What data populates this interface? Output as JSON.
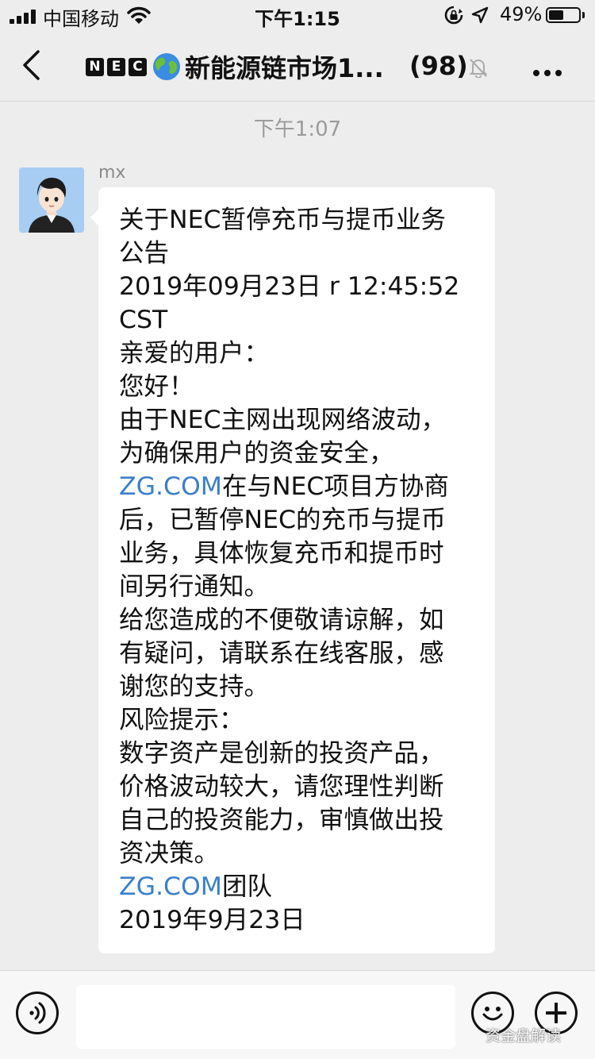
{
  "status_bar": {
    "carrier": "中国移动",
    "time": "下午1:15",
    "battery_percent": "49%",
    "battery_level": 0.49
  },
  "nav": {
    "title": "新能源链市场1...",
    "member_count": "(98)",
    "logo_letters": [
      "N",
      "E",
      "C"
    ],
    "icons": [
      "back-chevron-icon",
      "globe-icon",
      "mute-bell-icon",
      "more-icon"
    ]
  },
  "chat": {
    "time_label": "下午1:07",
    "sender": "mx",
    "message_lines": [
      {
        "text": "关于NEC暂停充币与提币业务"
      },
      {
        "text": "公告"
      },
      {
        "text": "2019年09月23日 r 12:45:52"
      },
      {
        "text": "CST"
      },
      {
        "text": "亲爱的用户："
      },
      {
        "text": "您好！"
      },
      {
        "text": "由于NEC主网出现网络波动，"
      },
      {
        "text": "为确保用户的资金安全，"
      },
      {
        "link": "ZG.COM",
        "text": "在与NEC项目方协商"
      },
      {
        "text": "后，已暂停NEC的充币与提币"
      },
      {
        "text": "业务，具体恢复充币和提币时"
      },
      {
        "text": "间另行通知。"
      },
      {
        "text": "给您造成的不便敬请谅解，如"
      },
      {
        "text": "有疑问，请联系在线客服，感"
      },
      {
        "text": "谢您的支持。"
      },
      {
        "text": "风险提示："
      },
      {
        "text": "数字资产是创新的投资产品，"
      },
      {
        "text": "价格波动较大，请您理性判断"
      },
      {
        "text": "自己的投资能力，审慎做出投"
      },
      {
        "text": "资决策。"
      },
      {
        "link": "ZG.COM",
        "text": "团队"
      },
      {
        "text": "2019年9月23日"
      }
    ]
  },
  "input_bar": {
    "value": "",
    "placeholder": "",
    "icons": [
      "voice-icon",
      "emoji-icon",
      "plus-icon"
    ]
  },
  "watermark": "资金盘解读",
  "colors": {
    "background": "#ededed",
    "bubble": "#ffffff",
    "link": "#3b7fc9",
    "time_label": "#9b9b9b"
  }
}
